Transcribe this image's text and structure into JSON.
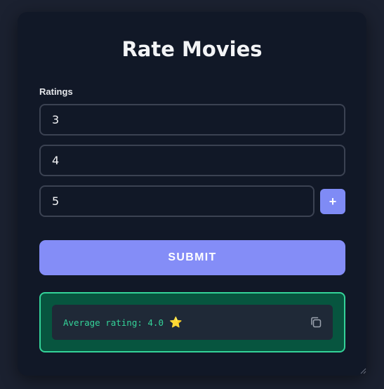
{
  "form": {
    "title": "Rate Movies",
    "ratings_label": "Ratings",
    "ratings": [
      "3",
      "4",
      "5"
    ],
    "add_label": "+",
    "submit_label": "SUBMIT"
  },
  "result": {
    "text": "Average rating: 4.0",
    "star": "⭐",
    "copy_icon": "copy-icon"
  },
  "colors": {
    "accent": "#848df7",
    "success_bg": "#07553f",
    "success_border": "#34d399",
    "success_text": "#34d399"
  }
}
